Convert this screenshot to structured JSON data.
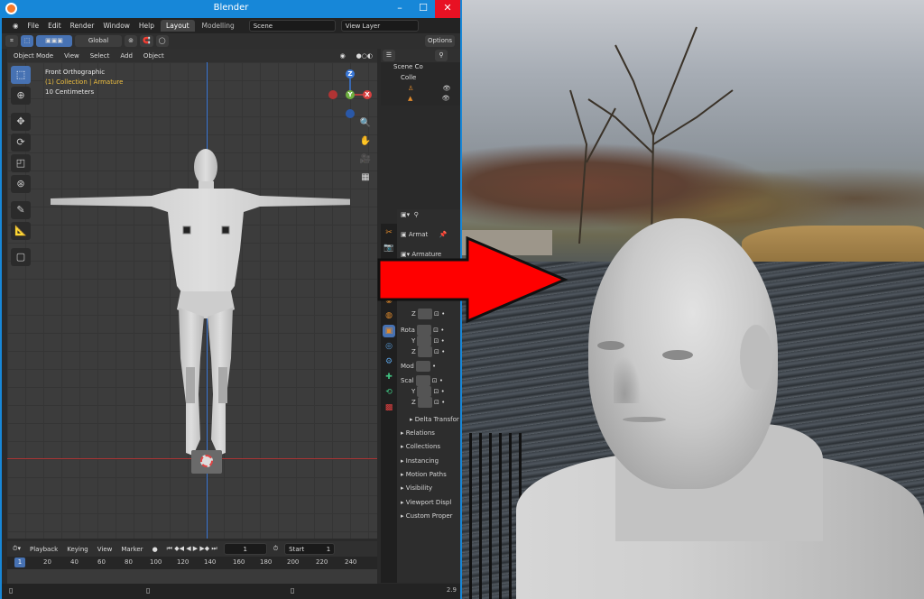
{
  "window": {
    "title": "Blender"
  },
  "menu": {
    "items": [
      "File",
      "Edit",
      "Render",
      "Window",
      "Help"
    ],
    "tabs": [
      "Layout",
      "Modelling"
    ],
    "scene_field": "Scene",
    "view_layer_field": "View Layer"
  },
  "tool_header": {
    "orientation": "Global",
    "options": "Options"
  },
  "view_header": {
    "mode": "Object Mode",
    "items": [
      "View",
      "Select",
      "Add",
      "Object"
    ]
  },
  "viewport": {
    "info_line1": "Front Orthographic",
    "info_line2": "(1) Collection | Armature",
    "info_line3": "10 Centimeters"
  },
  "gizmo": {
    "z": "Z",
    "y": "Y",
    "x": "X"
  },
  "outliner": {
    "scene": "Scene Co",
    "collection": "Colle"
  },
  "properties": {
    "object_name": "Armat",
    "data_name": "Armature",
    "labels": {
      "z1": "Z",
      "rot": "Rota",
      "y1": "Y",
      "z2": "Z",
      "mode": "Mod",
      "scale": "Scal",
      "y2": "Y",
      "z3": "Z",
      "delta": "Delta Transfor"
    },
    "panels": [
      "Relations",
      "Collections",
      "Instancing",
      "Motion Paths",
      "Visibility",
      "Viewport Displ",
      "Custom Proper"
    ]
  },
  "timeline": {
    "items": [
      "Playback",
      "Keying",
      "View",
      "Marker"
    ],
    "current_frame": "1",
    "start_label": "Start",
    "start_value": "1",
    "ruler_ticks": [
      "1",
      "20",
      "40",
      "60",
      "80",
      "100",
      "120",
      "140",
      "160",
      "180",
      "200",
      "220",
      "240"
    ]
  },
  "statusbar": {
    "version": "2.9"
  },
  "colors": {
    "window_accent": "#1787d8",
    "selection_blue": "#4772b3",
    "arrow": "#ff0000",
    "collection_text": "#f0c040"
  }
}
